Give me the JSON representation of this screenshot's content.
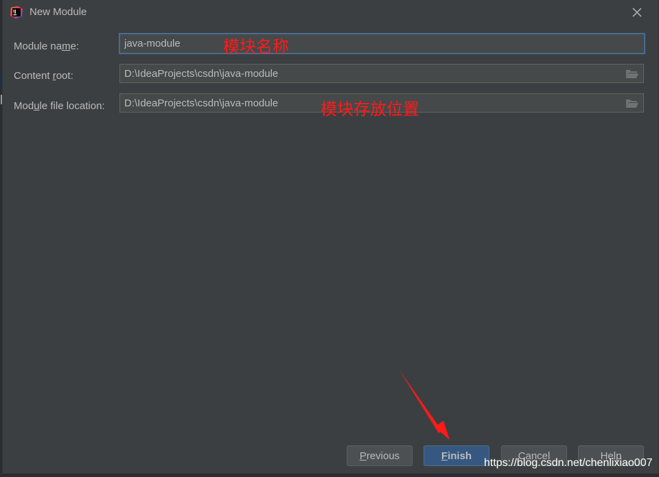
{
  "window": {
    "title": "New Module",
    "app_icon": "intellij-idea-icon",
    "close_icon": "close-icon"
  },
  "form": {
    "module_name": {
      "label_pre": "Module na",
      "label_mnemonic": "m",
      "label_post": "e:",
      "value": "java-module"
    },
    "content_root": {
      "label_pre": "Content ",
      "label_mnemonic": "r",
      "label_post": "oot:",
      "value": "D:\\IdeaProjects\\csdn\\java-module",
      "browse_icon": "folder-open-icon"
    },
    "module_file_location": {
      "label_pre": "Mod",
      "label_mnemonic": "u",
      "label_post": "le file location:",
      "value": "D:\\IdeaProjects\\csdn\\java-module",
      "browse_icon": "folder-open-icon"
    }
  },
  "annotations": {
    "module_name_note": "模块名称",
    "location_note": "模块存放位置",
    "arrow_target": "Finish",
    "color": "#ff1a1a"
  },
  "buttons": {
    "previous": {
      "mnemonic": "P",
      "rest": "revious"
    },
    "finish": {
      "mnemonic": "F",
      "rest": "inish"
    },
    "cancel": {
      "label": "Cancel"
    },
    "help": {
      "label": "Help"
    }
  },
  "watermark": "https://blog.csdn.net/chenlixiao007",
  "colors": {
    "dialog_bg": "#3c3f41",
    "field_bg": "#45494a",
    "focus_border": "#466d94",
    "primary_button": "#365880",
    "text": "#bbbbbb"
  }
}
